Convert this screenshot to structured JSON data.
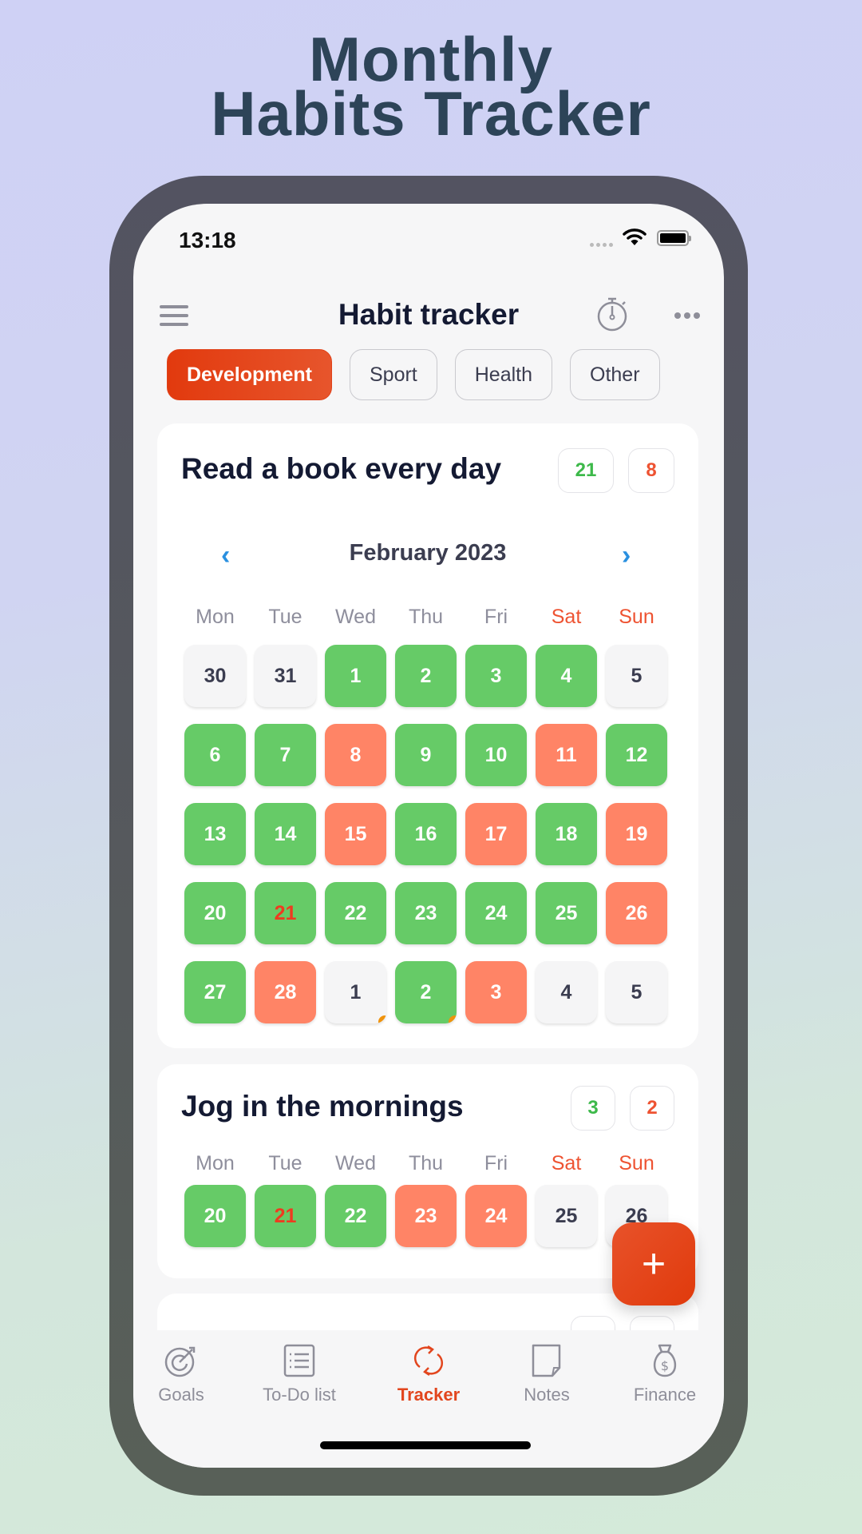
{
  "headline": {
    "line1": "Monthly",
    "line2": "Habits Tracker"
  },
  "status_bar": {
    "time": "13:18"
  },
  "nav": {
    "title": "Habit tracker",
    "menu_icon": "hamburger-icon",
    "timer_icon": "stopwatch-icon",
    "more_icon": "more-dots-icon"
  },
  "categories": [
    {
      "label": "Development",
      "active": true
    },
    {
      "label": "Sport",
      "active": false
    },
    {
      "label": "Health",
      "active": false
    },
    {
      "label": "Other",
      "active": false
    }
  ],
  "colors": {
    "accent": "#e2461e",
    "done": "#66cb67",
    "missed": "#ff8466",
    "empty": "#f5f5f6",
    "weekend": "#ee5332",
    "nav_arrow": "#2a90e0"
  },
  "weekdays": [
    {
      "label": "Mon",
      "weekend": false
    },
    {
      "label": "Tue",
      "weekend": false
    },
    {
      "label": "Wed",
      "weekend": false
    },
    {
      "label": "Thu",
      "weekend": false
    },
    {
      "label": "Fri",
      "weekend": false
    },
    {
      "label": "Sat",
      "weekend": true
    },
    {
      "label": "Sun",
      "weekend": true
    }
  ],
  "habits": [
    {
      "title": "Read a book every day",
      "done_count": "21",
      "missed_count": "8",
      "month_label": "February 2023",
      "prev_icon": "chevron-left-icon",
      "next_icon": "chevron-right-icon",
      "days": [
        {
          "d": "30",
          "s": "empty"
        },
        {
          "d": "31",
          "s": "empty"
        },
        {
          "d": "1",
          "s": "done"
        },
        {
          "d": "2",
          "s": "done"
        },
        {
          "d": "3",
          "s": "done"
        },
        {
          "d": "4",
          "s": "done"
        },
        {
          "d": "5",
          "s": "empty"
        },
        {
          "d": "6",
          "s": "done"
        },
        {
          "d": "7",
          "s": "done"
        },
        {
          "d": "8",
          "s": "missed"
        },
        {
          "d": "9",
          "s": "done"
        },
        {
          "d": "10",
          "s": "done"
        },
        {
          "d": "11",
          "s": "missed"
        },
        {
          "d": "12",
          "s": "done"
        },
        {
          "d": "13",
          "s": "done"
        },
        {
          "d": "14",
          "s": "done"
        },
        {
          "d": "15",
          "s": "missed"
        },
        {
          "d": "16",
          "s": "done"
        },
        {
          "d": "17",
          "s": "missed"
        },
        {
          "d": "18",
          "s": "done"
        },
        {
          "d": "19",
          "s": "missed"
        },
        {
          "d": "20",
          "s": "done"
        },
        {
          "d": "21",
          "s": "done",
          "today": true
        },
        {
          "d": "22",
          "s": "done"
        },
        {
          "d": "23",
          "s": "done"
        },
        {
          "d": "24",
          "s": "done"
        },
        {
          "d": "25",
          "s": "done"
        },
        {
          "d": "26",
          "s": "missed"
        },
        {
          "d": "27",
          "s": "done"
        },
        {
          "d": "28",
          "s": "missed"
        },
        {
          "d": "1",
          "s": "empty",
          "note": true
        },
        {
          "d": "2",
          "s": "done",
          "note": true
        },
        {
          "d": "3",
          "s": "missed"
        },
        {
          "d": "4",
          "s": "empty"
        },
        {
          "d": "5",
          "s": "empty"
        }
      ]
    },
    {
      "title": "Jog in the mornings",
      "done_count": "3",
      "missed_count": "2",
      "days": [
        {
          "d": "20",
          "s": "done"
        },
        {
          "d": "21",
          "s": "done",
          "today": true
        },
        {
          "d": "22",
          "s": "done"
        },
        {
          "d": "23",
          "s": "missed"
        },
        {
          "d": "24",
          "s": "missed"
        },
        {
          "d": "25",
          "s": "empty"
        },
        {
          "d": "26",
          "s": "empty"
        }
      ]
    }
  ],
  "fab": {
    "label": "+",
    "icon": "plus-icon"
  },
  "tabbar": [
    {
      "label": "Goals",
      "icon": "target-icon",
      "active": false
    },
    {
      "label": "To-Do list",
      "icon": "checklist-icon",
      "active": false
    },
    {
      "label": "Tracker",
      "icon": "refresh-cycle-icon",
      "active": true
    },
    {
      "label": "Notes",
      "icon": "note-page-icon",
      "active": false
    },
    {
      "label": "Finance",
      "icon": "money-bag-icon",
      "active": false
    }
  ]
}
